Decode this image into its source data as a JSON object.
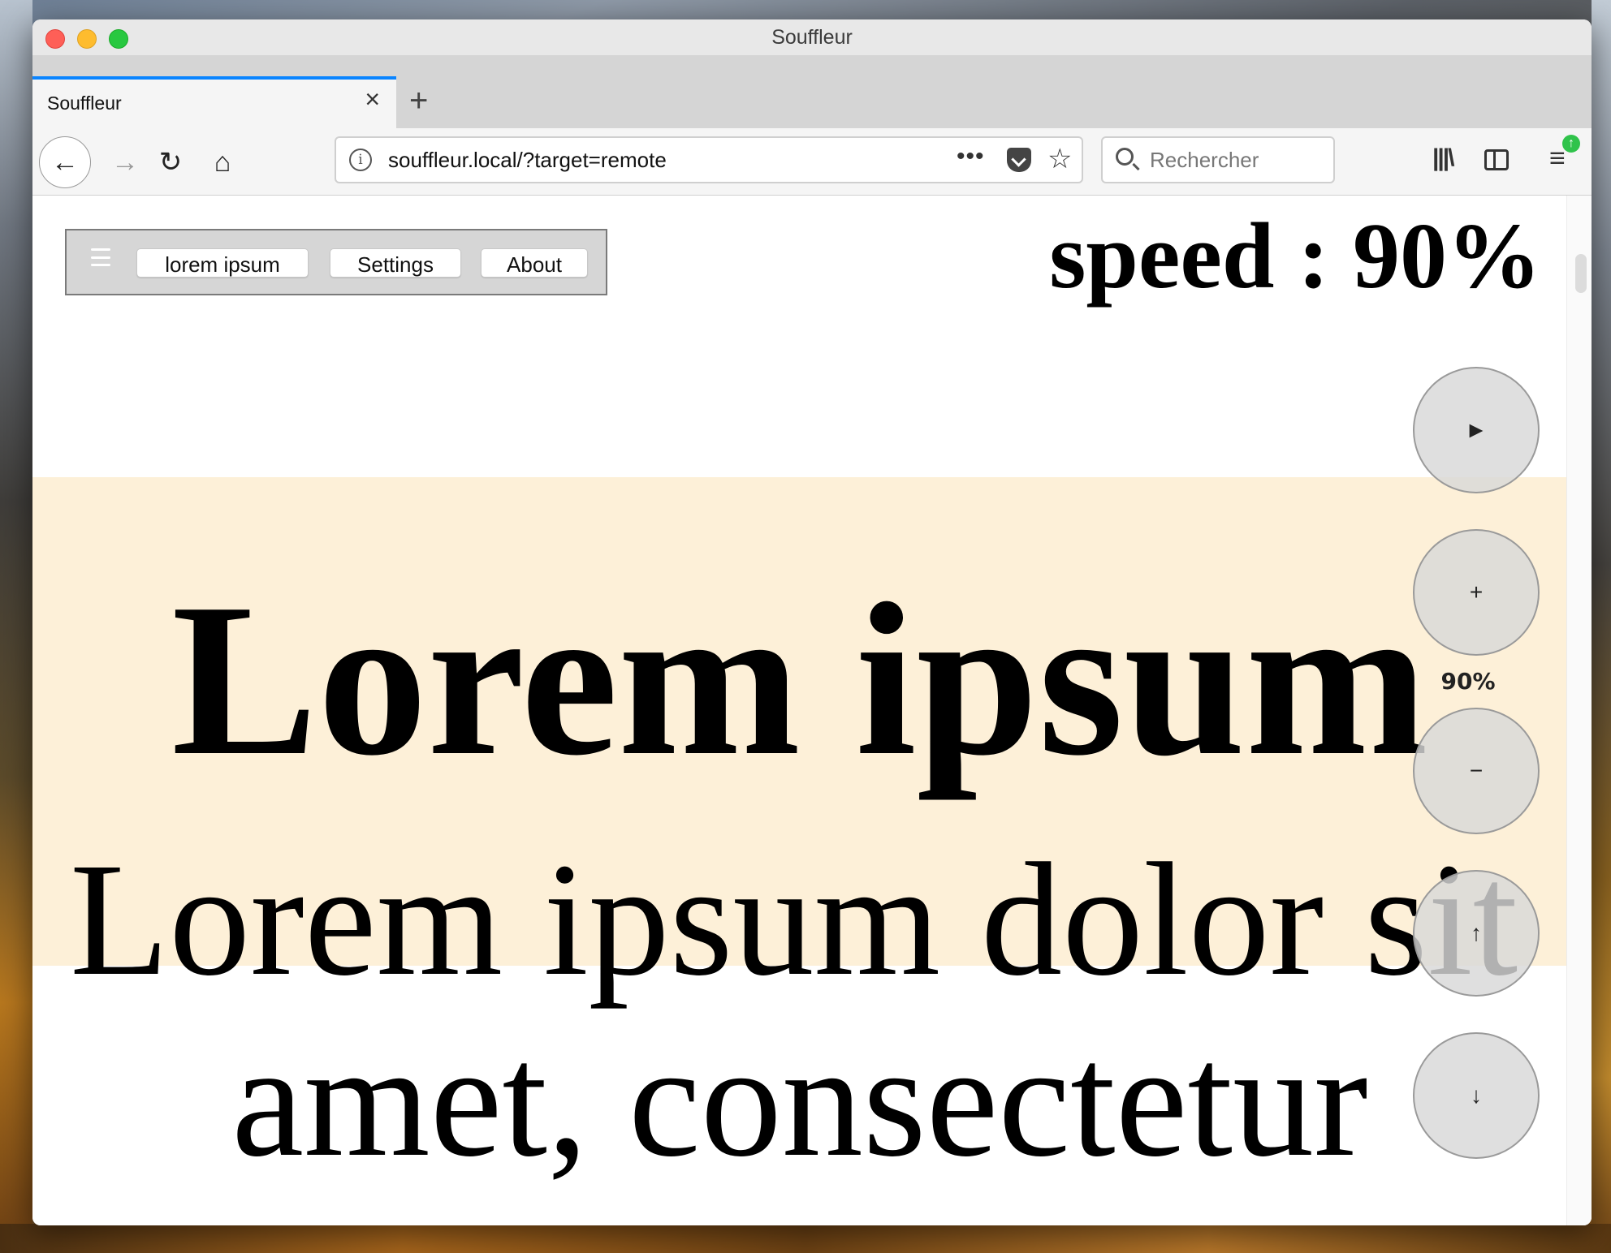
{
  "window": {
    "title": "Souffleur"
  },
  "tabs": [
    {
      "label": "Souffleur",
      "close_icon": "×"
    }
  ],
  "new_tab_icon": "+",
  "nav": {
    "back_icon": "←",
    "forward_icon": "→",
    "reload_icon": "↻",
    "home_icon": "⌂"
  },
  "urlbar": {
    "info_icon": "i",
    "url": "souffleur.local/?target=remote",
    "more_icon": "•••",
    "star_icon": "☆"
  },
  "search": {
    "placeholder": "Rechercher"
  },
  "toolbar": {
    "library_icon": "|||\\",
    "menu_icon": "≡",
    "update_icon": "↑"
  },
  "app_menu": {
    "items": [
      {
        "label": "lorem ipsum"
      },
      {
        "label": "Settings"
      },
      {
        "label": "About"
      }
    ]
  },
  "speed_display": "speed : 90%",
  "prompter": {
    "heading": "Lorem ipsum",
    "lines": [
      "Lorem ipsum dolor sit",
      "amet, consectetur"
    ]
  },
  "controls": {
    "play_icon": "►",
    "plus_icon": "+",
    "speed_label": "90%",
    "minus_icon": "−",
    "up_icon": "↑",
    "down_icon": "↓"
  },
  "colors": {
    "tab_accent": "#0a84ff",
    "highlight_band": "#fdf0d8",
    "menu_background": "#d6d6d6",
    "update_badge": "#30c34b"
  }
}
